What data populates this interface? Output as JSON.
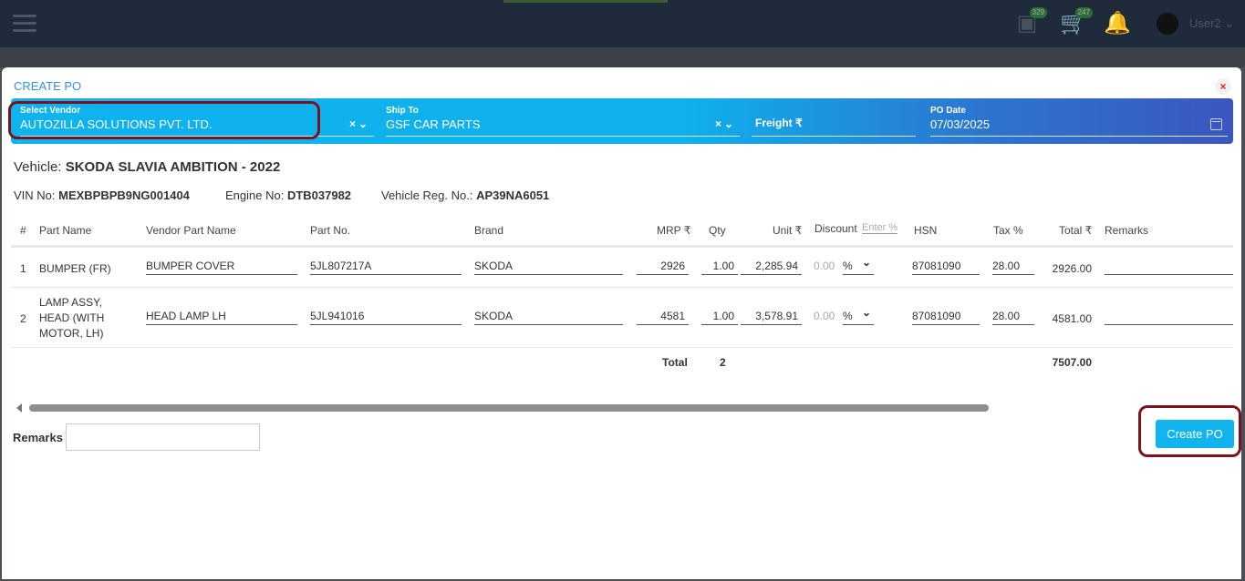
{
  "topbar": {
    "cart_badge_1": "329",
    "cart_badge_2": "247",
    "username": "User2 ⌄"
  },
  "modal": {
    "title": "CREATE PO",
    "close": "×"
  },
  "form": {
    "vendor_label": "Select Vendor",
    "vendor_value": "AUTOZILLA SOLUTIONS PVT. LTD.",
    "ship_label": "Ship To",
    "ship_value": "GSF CAR PARTS",
    "freight_label": "Freight ₹",
    "date_label": "PO Date",
    "date_value": "07/03/2025",
    "clear_toggle": "×⌄"
  },
  "vehicle": {
    "prefix": "Vehicle: ",
    "name": "SKODA SLAVIA AMBITION - 2022",
    "vin_label": "VIN No: ",
    "vin": "MEXBPBPB9NG001404",
    "engine_label": "Engine No: ",
    "engine": "DTB037982",
    "reg_label": "Vehicle Reg. No.: ",
    "reg": "AP39NA6051"
  },
  "table": {
    "headers": {
      "num": "#",
      "part_name": "Part Name",
      "vendor_part": "Vendor Part Name",
      "part_no": "Part No.",
      "brand": "Brand",
      "mrp": "MRP ₹",
      "qty": "Qty",
      "unit": "Unit ₹",
      "discount": "Discount",
      "discount_placeholder": "Enter %",
      "hsn": "HSN",
      "tax": "Tax %",
      "total": "Total ₹",
      "remarks": "Remarks"
    },
    "rows": [
      {
        "num": "1",
        "part_name": "BUMPER (FR)",
        "vendor_part": "BUMPER COVER",
        "part_no": "5JL807217A",
        "brand": "SKODA",
        "mrp": "2926",
        "qty": "1.00",
        "unit": "2,285.94",
        "discount": "0.00",
        "disc_type": "%",
        "hsn": "87081090",
        "tax": "28.00",
        "total": "2926.00"
      },
      {
        "num": "2",
        "part_name": "LAMP ASSY, HEAD (WITH MOTOR, LH)",
        "vendor_part": "HEAD LAMP LH",
        "part_no": "5JL941016",
        "brand": "SKODA",
        "mrp": "4581",
        "qty": "1.00",
        "unit": "3,578.91",
        "discount": "0.00",
        "disc_type": "%",
        "hsn": "87081090",
        "tax": "28.00",
        "total": "4581.00"
      }
    ],
    "total_label": "Total",
    "total_qty": "2",
    "grand_total": "7507.00"
  },
  "footer": {
    "remarks_label": "Remarks",
    "create_button": "Create PO"
  }
}
